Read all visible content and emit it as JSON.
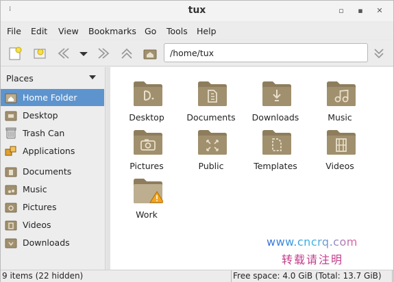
{
  "window": {
    "title": "tux"
  },
  "menubar": [
    "File",
    "Edit",
    "View",
    "Bookmarks",
    "Go",
    "Tools",
    "Help"
  ],
  "path": {
    "value": "/home/tux"
  },
  "sidebar": {
    "header": "Places",
    "items": [
      {
        "label": "Home Folder",
        "icon": "home-folder-icon",
        "active": true
      },
      {
        "label": "Desktop",
        "icon": "desktop-icon"
      },
      {
        "label": "Trash Can",
        "icon": "trash-icon"
      },
      {
        "label": "Applications",
        "icon": "applications-icon"
      },
      {
        "label": "Documents",
        "icon": "documents-folder-icon"
      },
      {
        "label": "Music",
        "icon": "music-folder-icon"
      },
      {
        "label": "Pictures",
        "icon": "pictures-folder-icon"
      },
      {
        "label": "Videos",
        "icon": "videos-folder-icon"
      },
      {
        "label": "Downloads",
        "icon": "downloads-folder-icon"
      }
    ]
  },
  "files": [
    {
      "name": "Desktop",
      "emblem": "desktop"
    },
    {
      "name": "Documents",
      "emblem": "document"
    },
    {
      "name": "Downloads",
      "emblem": "download"
    },
    {
      "name": "Music",
      "emblem": "music"
    },
    {
      "name": "Pictures",
      "emblem": "camera"
    },
    {
      "name": "Public",
      "emblem": "share"
    },
    {
      "name": "Templates",
      "emblem": "template"
    },
    {
      "name": "Videos",
      "emblem": "film"
    },
    {
      "name": "Work",
      "emblem": "warning"
    }
  ],
  "status": {
    "items": "9 items (22 hidden)",
    "free_space": "Free space: 4.0 GiB (Total: 13.7 GiB)"
  },
  "watermark": {
    "url": "www.cncrq.com",
    "text": "转载请注明"
  },
  "colors": {
    "folder": "#a1906e",
    "folder_light": "#bcae8f",
    "selection": "#5e94ce"
  }
}
